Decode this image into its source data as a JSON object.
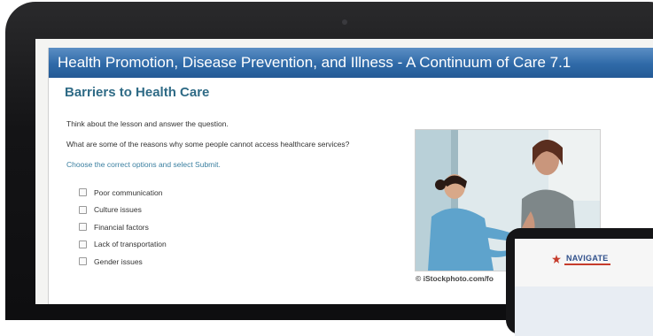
{
  "window": {
    "title": "Health Promotion, Disease Prevention, and Illness - A Continuum of Care 7.1"
  },
  "lesson": {
    "heading": "Barriers to Health Care",
    "instruction": "Think about the lesson and answer the question.",
    "question": "What are some of the reasons why some people cannot access healthcare services?",
    "direction": "Choose the correct options and select Submit.",
    "options": [
      {
        "label": "Poor communication",
        "checked": false
      },
      {
        "label": "Culture issues",
        "checked": false
      },
      {
        "label": "Financial factors",
        "checked": false
      },
      {
        "label": "Lack of transportation",
        "checked": false
      },
      {
        "label": "Gender issues",
        "checked": false
      }
    ],
    "image_credit": "© iStockphoto.com/fo"
  },
  "tablet": {
    "brand": "NAVIGATE"
  },
  "colors": {
    "titlebar": "#2f6aa8",
    "heading": "#2f6b86",
    "direction": "#3a7fa0",
    "bezel": "#141416"
  }
}
